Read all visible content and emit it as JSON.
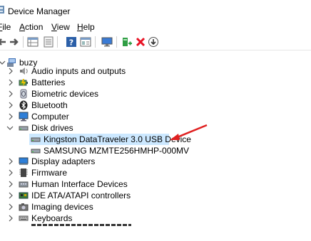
{
  "window": {
    "title": "Device Manager"
  },
  "menu": [
    {
      "label": "File",
      "underline": "F",
      "rest": "ile"
    },
    {
      "label": "Action",
      "underline": "A",
      "rest": "ction"
    },
    {
      "label": "View",
      "underline": "V",
      "rest": "iew"
    },
    {
      "label": "Help",
      "underline": "H",
      "rest": "elp"
    }
  ],
  "toolbar": {
    "icons": [
      "back-arrow-icon",
      "forward-arrow-icon",
      "properties-grid-icon",
      "show-hidden-icon",
      "help-icon",
      "properties-list-icon",
      "monitor-scan-icon",
      "update-driver-icon",
      "uninstall-x-icon",
      "download-icon"
    ]
  },
  "tree": {
    "root": "buzy",
    "categories": [
      {
        "label": "Audio inputs and outputs",
        "icon": "speaker-icon",
        "expanded": false
      },
      {
        "label": "Batteries",
        "icon": "battery-icon",
        "expanded": false
      },
      {
        "label": "Biometric devices",
        "icon": "biometric-icon",
        "expanded": false
      },
      {
        "label": "Bluetooth",
        "icon": "bluetooth-icon",
        "expanded": false
      },
      {
        "label": "Computer",
        "icon": "computer-icon",
        "expanded": false
      },
      {
        "label": "Disk drives",
        "icon": "disk-drive-icon",
        "expanded": true,
        "children": [
          {
            "label": "Kingston DataTraveler 3.0 USB Device",
            "icon": "disk-drive-icon",
            "selected": true
          },
          {
            "label": "SAMSUNG MZMTE256HMHP-000MV",
            "icon": "disk-drive-icon",
            "selected": false
          }
        ]
      },
      {
        "label": "Display adapters",
        "icon": "display-adapter-icon",
        "expanded": false
      },
      {
        "label": "Firmware",
        "icon": "firmware-icon",
        "expanded": false
      },
      {
        "label": "Human Interface Devices",
        "icon": "hid-icon",
        "expanded": false
      },
      {
        "label": "IDE ATA/ATAPI controllers",
        "icon": "ide-controller-icon",
        "expanded": false
      },
      {
        "label": "Imaging devices",
        "icon": "camera-icon",
        "expanded": false
      },
      {
        "label": "Keyboards",
        "icon": "keyboard-icon",
        "expanded": false
      }
    ]
  },
  "colors": {
    "selection": "#cce8ff",
    "annotation_arrow": "#e02020",
    "uninstall": "#e81123"
  }
}
